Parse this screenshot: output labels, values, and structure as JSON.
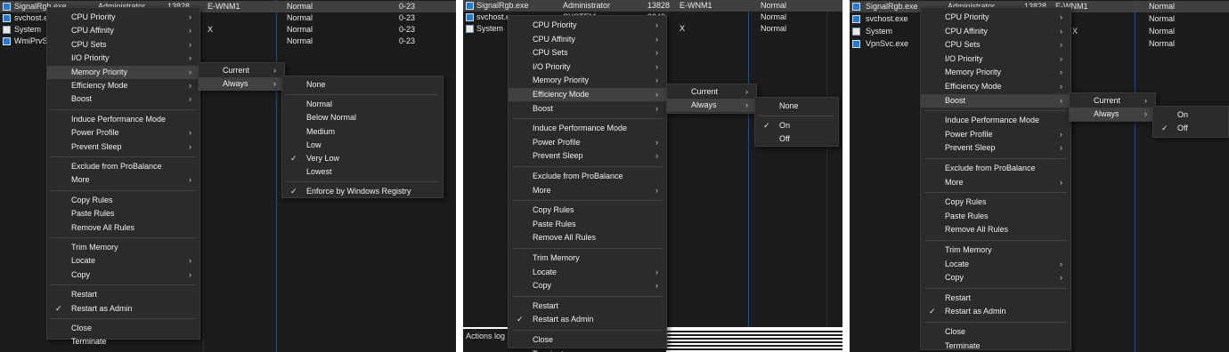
{
  "columns": {
    "normal": "Normal",
    "cpu_sets": "0-23",
    "cpu_count": "X"
  },
  "panel1": {
    "processes": [
      {
        "name": "SignalRgb.exe",
        "user": "Administrator",
        "pid": "13828",
        "cpu": "E-WNM1",
        "priority": "Normal",
        "affinity": "0-23"
      },
      {
        "name": "svchost.exe",
        "priority": "Normal",
        "affinity": "0-23"
      },
      {
        "name": "System",
        "mark": "X",
        "priority": "Normal",
        "affinity": "0-23"
      },
      {
        "name": "WmiPrvSE.exe",
        "priority": "Normal",
        "affinity": "0-23"
      }
    ],
    "menu": [
      {
        "label": "CPU Priority",
        "arrow": true
      },
      {
        "label": "CPU Affinity",
        "arrow": true
      },
      {
        "label": "CPU Sets",
        "arrow": true
      },
      {
        "label": "I/O Priority",
        "arrow": true
      },
      {
        "label": "Memory Priority",
        "arrow": true,
        "highlight": true
      },
      {
        "label": "Efficiency Mode",
        "arrow": true
      },
      {
        "label": "Boost",
        "arrow": true
      },
      {
        "label": "Induce Performance Mode"
      },
      {
        "label": "Power Profile",
        "arrow": true
      },
      {
        "label": "Prevent Sleep",
        "arrow": true
      },
      {
        "label": "Exclude from ProBalance"
      },
      {
        "label": "More",
        "arrow": true
      },
      {
        "label": "Copy Rules"
      },
      {
        "label": "Paste Rules"
      },
      {
        "label": "Remove All Rules"
      },
      {
        "label": "Trim Memory"
      },
      {
        "label": "Locate",
        "arrow": true
      },
      {
        "label": "Copy",
        "arrow": true
      },
      {
        "label": "Restart"
      },
      {
        "label": "Restart as Admin",
        "checked": true
      },
      {
        "label": "Close"
      },
      {
        "label": "Terminate"
      }
    ],
    "submenu": [
      {
        "label": "Current",
        "arrow": true
      },
      {
        "label": "Always",
        "arrow": true,
        "highlight": true
      }
    ],
    "submenu2": [
      {
        "label": "None"
      },
      {
        "label": "Normal"
      },
      {
        "label": "Below Normal"
      },
      {
        "label": "Medium"
      },
      {
        "label": "Low"
      },
      {
        "label": "Very Low",
        "checked": true
      },
      {
        "label": "Lowest"
      },
      {
        "label": "Enforce by Windows Registry",
        "checked": true
      }
    ]
  },
  "panel2": {
    "processes": [
      {
        "name": "SignalRgb.exe",
        "user": "Administrator",
        "pid": "13828",
        "cpu": "E-WNM1",
        "priority": "Normal"
      },
      {
        "name": "svchost.exe",
        "user": "SYSTEM",
        "pid": "3348",
        "priority": "Normal"
      },
      {
        "name": "System",
        "mark": "X",
        "priority": "Normal"
      }
    ],
    "menu": [
      {
        "label": "CPU Priority",
        "arrow": true
      },
      {
        "label": "CPU Affinity",
        "arrow": true
      },
      {
        "label": "CPU Sets",
        "arrow": true
      },
      {
        "label": "I/O Priority",
        "arrow": true
      },
      {
        "label": "Memory Priority",
        "arrow": true
      },
      {
        "label": "Efficiency Mode",
        "arrow": true,
        "highlight": true
      },
      {
        "label": "Boost",
        "arrow": true
      },
      {
        "label": "Induce Performance Mode"
      },
      {
        "label": "Power Profile",
        "arrow": true
      },
      {
        "label": "Prevent Sleep",
        "arrow": true
      },
      {
        "label": "Exclude from ProBalance"
      },
      {
        "label": "More",
        "arrow": true
      },
      {
        "label": "Copy Rules"
      },
      {
        "label": "Paste Rules"
      },
      {
        "label": "Remove All Rules"
      },
      {
        "label": "Trim Memory"
      },
      {
        "label": "Locate",
        "arrow": true
      },
      {
        "label": "Copy",
        "arrow": true
      },
      {
        "label": "Restart"
      },
      {
        "label": "Restart as Admin",
        "checked": true
      },
      {
        "label": "Close"
      },
      {
        "label": "Terminate"
      }
    ],
    "submenu": [
      {
        "label": "Current",
        "arrow": true
      },
      {
        "label": "Always",
        "arrow": true,
        "highlight": true
      }
    ],
    "submenu2": [
      {
        "label": "None"
      },
      {
        "label": "On",
        "checked": true
      },
      {
        "label": "Off"
      }
    ],
    "status": "Actions log"
  },
  "panel3": {
    "processes": [
      {
        "name": "SignalRgb.exe",
        "user": "Administrator",
        "pid": "13828",
        "cpu": "E-WNM1",
        "priority": "Normal"
      },
      {
        "name": "svchost.exe",
        "priority": "Normal"
      },
      {
        "name": "System",
        "mark": "X",
        "priority": "Normal"
      },
      {
        "name": "VpnSvc.exe",
        "priority": "Normal"
      }
    ],
    "menu": [
      {
        "label": "CPU Priority",
        "arrow": true
      },
      {
        "label": "CPU Affinity",
        "arrow": true
      },
      {
        "label": "CPU Sets",
        "arrow": true
      },
      {
        "label": "I/O Priority",
        "arrow": true
      },
      {
        "label": "Memory Priority",
        "arrow": true
      },
      {
        "label": "Efficiency Mode",
        "arrow": true
      },
      {
        "label": "Boost",
        "arrow": true,
        "highlight": true
      },
      {
        "label": "Induce Performance Mode"
      },
      {
        "label": "Power Profile",
        "arrow": true
      },
      {
        "label": "Prevent Sleep",
        "arrow": true
      },
      {
        "label": "Exclude from ProBalance"
      },
      {
        "label": "More",
        "arrow": true
      },
      {
        "label": "Copy Rules"
      },
      {
        "label": "Paste Rules"
      },
      {
        "label": "Remove All Rules"
      },
      {
        "label": "Trim Memory"
      },
      {
        "label": "Locate",
        "arrow": true
      },
      {
        "label": "Copy",
        "arrow": true
      },
      {
        "label": "Restart"
      },
      {
        "label": "Restart as Admin",
        "checked": true
      },
      {
        "label": "Close"
      },
      {
        "label": "Terminate"
      }
    ],
    "submenu": [
      {
        "label": "Current",
        "arrow": true
      },
      {
        "label": "Always",
        "arrow": true,
        "highlight": true
      }
    ],
    "submenu2": [
      {
        "label": "On"
      },
      {
        "label": "Off",
        "checked": true
      }
    ]
  },
  "glyphs": {
    "arrow": "›",
    "check": "✓"
  },
  "colors": {
    "background": "#1c1c1c",
    "menu": "#2b2b2b",
    "highlight": "#414141",
    "row_highlight": "#404040"
  }
}
